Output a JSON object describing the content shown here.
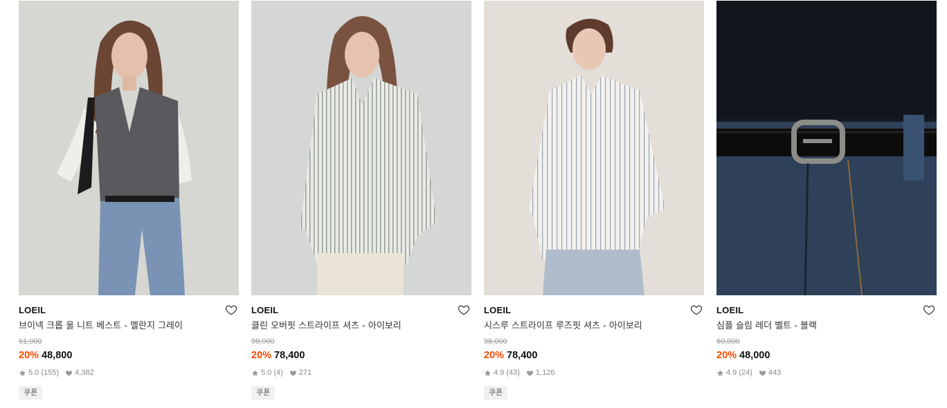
{
  "products": [
    {
      "brand": "LOEIL",
      "name": "브이넥 크롭 울 니트 베스트 - 멜란지 그레이",
      "original_price": "61,000",
      "discount": "20%",
      "price": "48,800",
      "rating": "5.0",
      "reviews": "(155)",
      "likes": "4,382",
      "coupon": "쿠폰",
      "image_subject": "model wearing grey knit vest over white shirt with jeans"
    },
    {
      "brand": "LOEIL",
      "name": "클린 오버핏 스트라이프 셔츠 - 아이보리",
      "original_price": "98,000",
      "discount": "20%",
      "price": "78,400",
      "rating": "5.0",
      "reviews": "(4)",
      "likes": "271",
      "coupon": "쿠폰",
      "image_subject": "model wearing oversized striped shirt with cream shorts"
    },
    {
      "brand": "LOEIL",
      "name": "시스루 스트라이프 루즈핏 셔츠 - 아이보리",
      "original_price": "98,000",
      "discount": "20%",
      "price": "78,400",
      "rating": "4.9",
      "reviews": "(43)",
      "likes": "1,126",
      "coupon": "쿠폰",
      "image_subject": "model wearing sheer striped loose shirt with light jeans"
    },
    {
      "brand": "LOEIL",
      "name": "심플 슬림 레더 벨트 - 블랙",
      "original_price": "60,000",
      "discount": "20%",
      "price": "48,000",
      "rating": "4.9",
      "reviews": "(24)",
      "likes": "443",
      "coupon": null,
      "image_subject": "close-up of black leather belt on dark denim"
    }
  ],
  "colors": {
    "discount": "#ff4800",
    "original_price": "#9a9a9a",
    "stats": "#888888"
  }
}
